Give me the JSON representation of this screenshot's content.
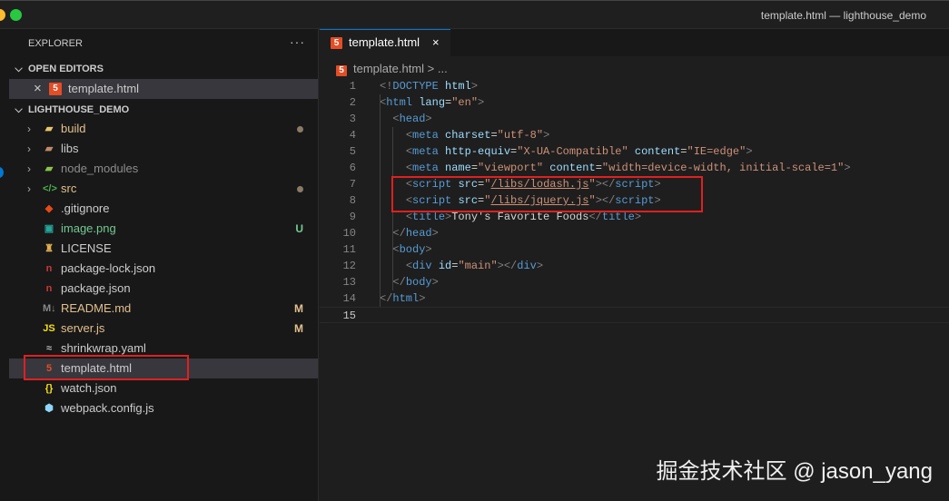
{
  "window": {
    "title": "template.html — lighthouse_demo",
    "traffic_colors": [
      "#febc2e",
      "#28c840"
    ]
  },
  "sidebar": {
    "header": "EXPLORER",
    "more": "···",
    "open_editors": {
      "label": "OPEN EDITORS",
      "items": [
        {
          "close": "×",
          "icon": "5",
          "label": "template.html"
        }
      ]
    },
    "project": {
      "label": "LIGHTHOUSE_DEMO",
      "items": [
        {
          "label": "build",
          "type": "folder",
          "icon": "▰",
          "icon_color": "#e8c46a",
          "color": "#e2c08d",
          "status": "dot"
        },
        {
          "label": "libs",
          "type": "folder",
          "icon": "▰",
          "icon_color": "#c08a6a",
          "color": "#cccccc"
        },
        {
          "label": "node_modules",
          "type": "folder",
          "icon": "▰",
          "icon_color": "#8bc34a",
          "color": "#8c8c8c"
        },
        {
          "label": "src",
          "type": "folder",
          "icon": "</>",
          "icon_color": "#4caf50",
          "color": "#e2c08d",
          "status": "dot"
        },
        {
          "label": ".gitignore",
          "icon": "◆",
          "icon_color": "#e64a19",
          "color": "#cccccc"
        },
        {
          "label": "image.png",
          "icon": "▣",
          "icon_color": "#26a69a",
          "color": "#73c991",
          "badge": "U",
          "badge_color": "#73c991"
        },
        {
          "label": "LICENSE",
          "icon": "♜",
          "icon_color": "#e0b050",
          "color": "#cccccc"
        },
        {
          "label": "package-lock.json",
          "icon": "n",
          "icon_color": "#cb3837",
          "color": "#cccccc"
        },
        {
          "label": "package.json",
          "icon": "n",
          "icon_color": "#cb3837",
          "color": "#cccccc"
        },
        {
          "label": "README.md",
          "icon": "M↓",
          "icon_color": "#888888",
          "color": "#e2c08d",
          "badge": "M",
          "badge_color": "#e2c08d"
        },
        {
          "label": "server.js",
          "icon": "JS",
          "icon_color": "#f5de19",
          "color": "#e2c08d",
          "badge": "M",
          "badge_color": "#e2c08d"
        },
        {
          "label": "shrinkwrap.yaml",
          "icon": "≈",
          "icon_color": "#bbbbbb",
          "color": "#cccccc"
        },
        {
          "label": "template.html",
          "icon": "5",
          "icon_color": "#e44d26",
          "color": "#cccccc",
          "highlighted": true
        },
        {
          "label": "watch.json",
          "icon": "{}",
          "icon_color": "#f5de19",
          "color": "#cccccc"
        },
        {
          "label": "webpack.config.js",
          "icon": "⬢",
          "icon_color": "#8ed6fb",
          "color": "#cccccc"
        }
      ]
    }
  },
  "editor": {
    "tab": {
      "icon": "5",
      "label": "template.html",
      "close": "×"
    },
    "breadcrumb": {
      "file": "template.html",
      "sep": ">",
      "rest": "..."
    },
    "current_line": 15,
    "lines": [
      [
        [
          "b",
          "<!"
        ],
        [
          "n",
          "DOCTYPE"
        ],
        [
          "x",
          " "
        ],
        [
          "a",
          "html"
        ],
        [
          "b",
          ">"
        ]
      ],
      [
        [
          "b",
          "<"
        ],
        [
          "n",
          "html"
        ],
        [
          "x",
          " "
        ],
        [
          "a",
          "lang"
        ],
        [
          "x",
          "="
        ],
        [
          "s",
          "\"en\""
        ],
        [
          "b",
          ">"
        ]
      ],
      [
        [
          "x",
          "  "
        ],
        [
          "b",
          "<"
        ],
        [
          "n",
          "head"
        ],
        [
          "b",
          ">"
        ]
      ],
      [
        [
          "x",
          "    "
        ],
        [
          "b",
          "<"
        ],
        [
          "n",
          "meta"
        ],
        [
          "x",
          " "
        ],
        [
          "a",
          "charset"
        ],
        [
          "x",
          "="
        ],
        [
          "s",
          "\"utf-8\""
        ],
        [
          "b",
          ">"
        ]
      ],
      [
        [
          "x",
          "    "
        ],
        [
          "b",
          "<"
        ],
        [
          "n",
          "meta"
        ],
        [
          "x",
          " "
        ],
        [
          "a",
          "http-equiv"
        ],
        [
          "x",
          "="
        ],
        [
          "s",
          "\"X-UA-Compatible\""
        ],
        [
          "x",
          " "
        ],
        [
          "a",
          "content"
        ],
        [
          "x",
          "="
        ],
        [
          "s",
          "\"IE=edge\""
        ],
        [
          "b",
          ">"
        ]
      ],
      [
        [
          "x",
          "    "
        ],
        [
          "b",
          "<"
        ],
        [
          "n",
          "meta"
        ],
        [
          "x",
          " "
        ],
        [
          "a",
          "name"
        ],
        [
          "x",
          "="
        ],
        [
          "s",
          "\"viewport\""
        ],
        [
          "x",
          " "
        ],
        [
          "a",
          "content"
        ],
        [
          "x",
          "="
        ],
        [
          "s",
          "\"width=device-width, initial-scale=1\""
        ],
        [
          "b",
          ">"
        ]
      ],
      [
        [
          "x",
          "    "
        ],
        [
          "b",
          "<"
        ],
        [
          "n",
          "script"
        ],
        [
          "x",
          " "
        ],
        [
          "a",
          "src"
        ],
        [
          "x",
          "="
        ],
        [
          "s",
          "\""
        ],
        [
          "u",
          "/libs/lodash.js"
        ],
        [
          "s",
          "\""
        ],
        [
          "b",
          "></"
        ],
        [
          "n",
          "script"
        ],
        [
          "b",
          ">"
        ]
      ],
      [
        [
          "x",
          "    "
        ],
        [
          "b",
          "<"
        ],
        [
          "n",
          "script"
        ],
        [
          "x",
          " "
        ],
        [
          "a",
          "src"
        ],
        [
          "x",
          "="
        ],
        [
          "s",
          "\""
        ],
        [
          "u",
          "/libs/jquery.js"
        ],
        [
          "s",
          "\""
        ],
        [
          "b",
          "></"
        ],
        [
          "n",
          "script"
        ],
        [
          "b",
          ">"
        ]
      ],
      [
        [
          "x",
          "    "
        ],
        [
          "b",
          "<"
        ],
        [
          "n",
          "title"
        ],
        [
          "b",
          ">"
        ],
        [
          "x",
          "Tony's Favorite Foods"
        ],
        [
          "b",
          "</"
        ],
        [
          "n",
          "title"
        ],
        [
          "b",
          ">"
        ]
      ],
      [
        [
          "x",
          "  "
        ],
        [
          "b",
          "</"
        ],
        [
          "n",
          "head"
        ],
        [
          "b",
          ">"
        ]
      ],
      [
        [
          "x",
          "  "
        ],
        [
          "b",
          "<"
        ],
        [
          "n",
          "body"
        ],
        [
          "b",
          ">"
        ]
      ],
      [
        [
          "x",
          "    "
        ],
        [
          "b",
          "<"
        ],
        [
          "n",
          "div"
        ],
        [
          "x",
          " "
        ],
        [
          "a",
          "id"
        ],
        [
          "x",
          "="
        ],
        [
          "s",
          "\"main\""
        ],
        [
          "b",
          "></"
        ],
        [
          "n",
          "div"
        ],
        [
          "b",
          ">"
        ]
      ],
      [
        [
          "x",
          "  "
        ],
        [
          "b",
          "</"
        ],
        [
          "n",
          "body"
        ],
        [
          "b",
          ">"
        ]
      ],
      [
        [
          "b",
          "</"
        ],
        [
          "n",
          "html"
        ],
        [
          "b",
          ">"
        ]
      ],
      [
        [
          "x",
          ""
        ]
      ]
    ]
  },
  "watermark": "掘金技术社区 @ jason_yang"
}
